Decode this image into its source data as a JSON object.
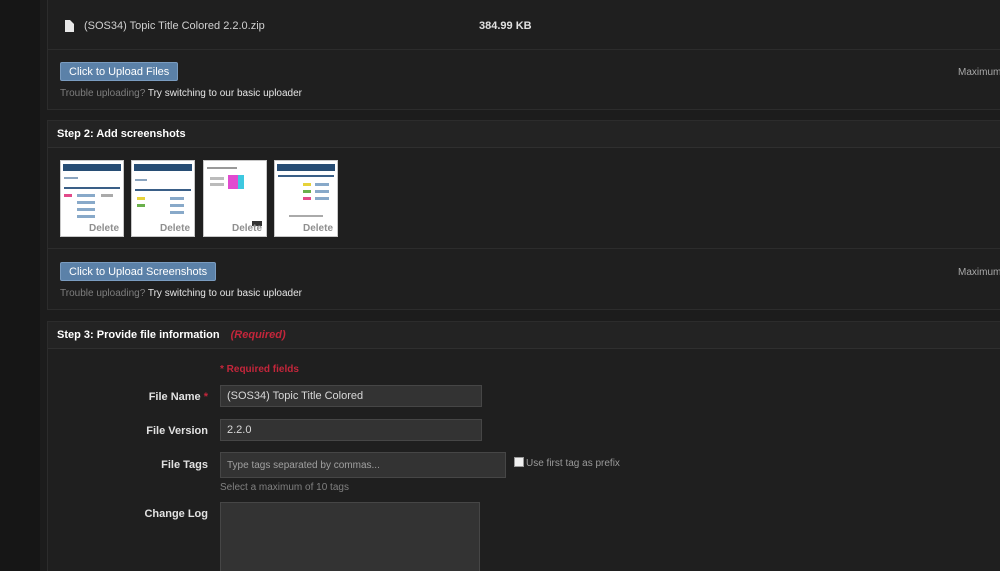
{
  "step1": {
    "file": {
      "name": "(SOS34) Topic Title Colored 2.2.0.zip",
      "size": "384.99 KB",
      "icon": "file-icon"
    },
    "upload_button": "Click to Upload Files",
    "max_note": "Maximum f",
    "trouble_prefix": "Trouble uploading?",
    "trouble_link": "Try switching to our basic uploader"
  },
  "step2": {
    "title": "Step 2: Add screenshots",
    "thumbnails": [
      {
        "delete_label": "Delete"
      },
      {
        "delete_label": "Delete"
      },
      {
        "delete_label": "Delete"
      },
      {
        "delete_label": "Delete"
      }
    ],
    "upload_button": "Click to Upload Screenshots",
    "max_note": "Maximum f",
    "trouble_prefix": "Trouble uploading?",
    "trouble_link": "Try switching to our basic uploader"
  },
  "step3": {
    "title": "Step 3: Provide file information",
    "required_tag": "(Required)",
    "required_fields": "* Required fields",
    "file_name_label": "File Name",
    "file_name_star": "*",
    "file_name_value": "(SOS34) Topic Title Colored",
    "file_version_label": "File Version",
    "file_version_value": "2.2.0",
    "file_tags_label": "File Tags",
    "file_tags_placeholder": "Type tags separated by commas...",
    "use_first_tag_label": "Use first tag as prefix",
    "tags_hint": "Select a maximum of 10 tags",
    "change_log_label": "Change Log"
  },
  "colors": {
    "accent_button": "#5b81a8",
    "required": "#c4263b",
    "background": "#1c1c1c"
  }
}
